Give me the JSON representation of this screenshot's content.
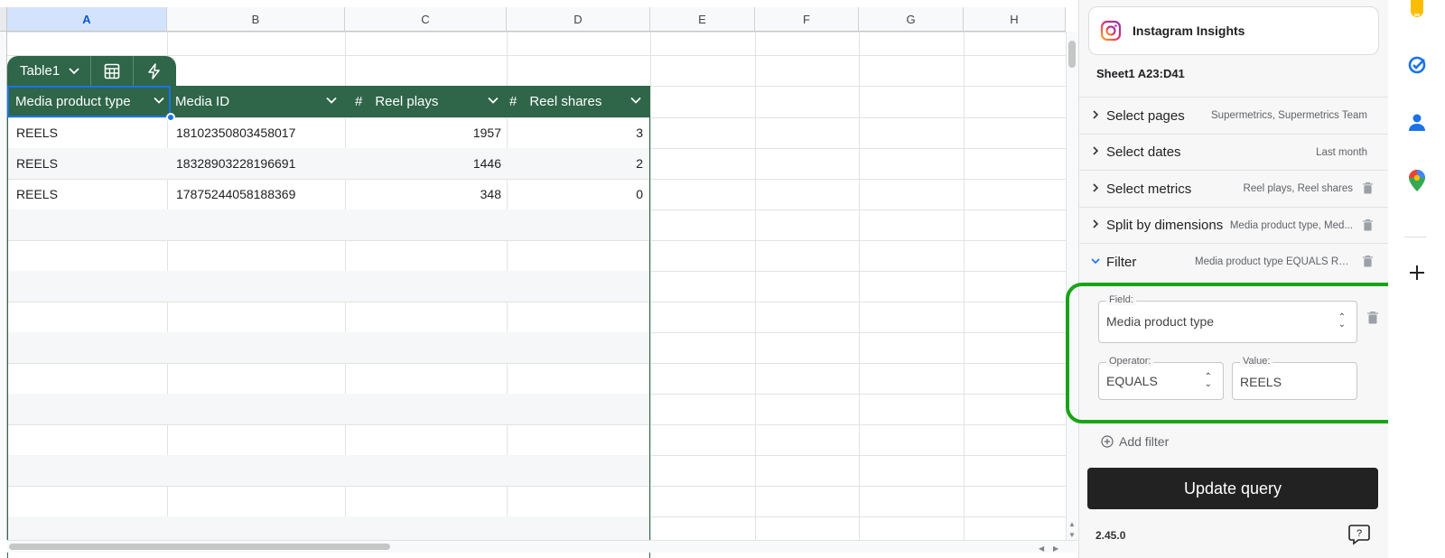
{
  "sheet": {
    "columns": [
      "A",
      "B",
      "C",
      "D",
      "E",
      "F",
      "G",
      "H"
    ],
    "selected_column": "A"
  },
  "table": {
    "name": "Table1",
    "headers": [
      {
        "label": "Media product type",
        "numeric": false
      },
      {
        "label": "Media ID",
        "numeric": false
      },
      {
        "label": "Reel plays",
        "numeric": true
      },
      {
        "label": "Reel shares",
        "numeric": true
      }
    ],
    "rows": [
      [
        "REELS",
        "18102350803458017",
        "1957",
        "3"
      ],
      [
        "REELS",
        "18328903228196691",
        "1446",
        "2"
      ],
      [
        "REELS",
        "17875244058188369",
        "348",
        "0"
      ]
    ],
    "hash_symbol": "#"
  },
  "panel": {
    "title": "Instagram Insights",
    "range": "Sheet1 A23:D41",
    "rows": [
      {
        "label": "Select pages",
        "value": "Supermetrics, Supermetrics Team",
        "deletable": false,
        "expanded": false
      },
      {
        "label": "Select dates",
        "value": "Last month",
        "deletable": false,
        "expanded": false
      },
      {
        "label": "Select metrics",
        "value": "Reel plays, Reel shares",
        "deletable": true,
        "expanded": false
      },
      {
        "label": "Split by dimensions",
        "value": "Media product type, Med...",
        "deletable": true,
        "expanded": false
      },
      {
        "label": "Filter",
        "value": "Media product type EQUALS REELS",
        "deletable": true,
        "expanded": true
      }
    ],
    "filter": {
      "field_caption": "Field:",
      "field_value": "Media product type",
      "operator_caption": "Operator:",
      "operator_value": "EQUALS",
      "value_caption": "Value:",
      "value_value": "REELS"
    },
    "add_filter": "Add filter",
    "update_button": "Update query",
    "version": "2.45.0"
  },
  "colors": {
    "table_green": "#2f6549",
    "highlight_green": "#17a517",
    "selection_blue": "#1a73e8"
  },
  "rail_icons": [
    "keep-icon",
    "tasks-icon",
    "contacts-icon",
    "maps-icon",
    "add-icon"
  ]
}
